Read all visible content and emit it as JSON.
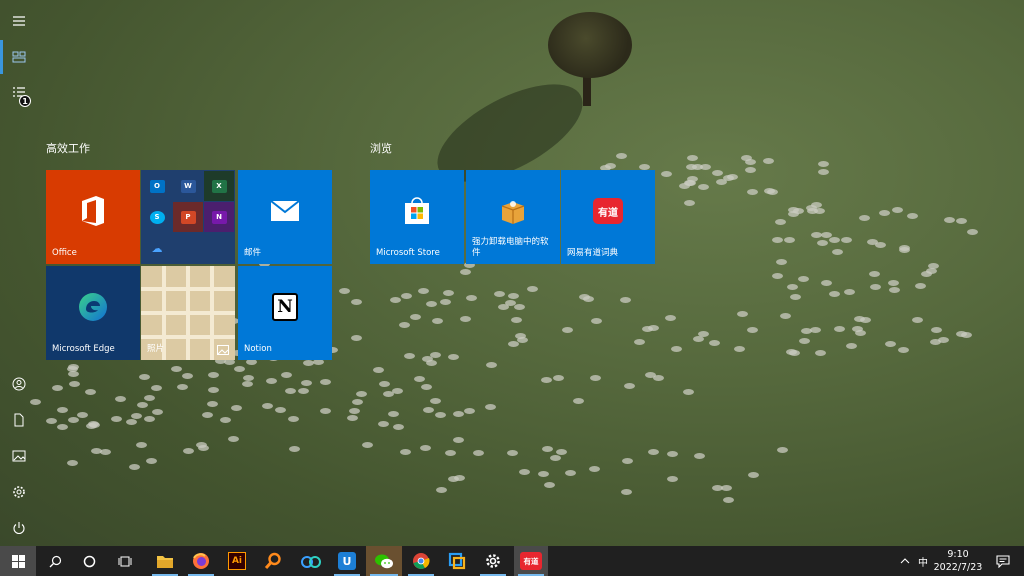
{
  "start_menu": {
    "groups": [
      {
        "title": "高效工作",
        "tiles": [
          {
            "label": "Office"
          },
          {
            "label": "邮件"
          },
          {
            "label": "Microsoft Edge"
          },
          {
            "label": "照片"
          },
          {
            "label": "Notion"
          }
        ],
        "mini_apps": [
          {
            "icon": "outlook-icon",
            "glyph": "O",
            "color": "#0072c6"
          },
          {
            "icon": "word-icon",
            "glyph": "W",
            "color": "#2b579a"
          },
          {
            "icon": "excel-icon",
            "glyph": "X",
            "color": "#217346"
          },
          {
            "icon": "skype-icon",
            "glyph": "S",
            "color": "#00aff0"
          },
          {
            "icon": "powerpoint-icon",
            "glyph": "P",
            "color": "#d24726"
          },
          {
            "icon": "onenote-icon",
            "glyph": "N",
            "color": "#7719aa"
          },
          {
            "icon": "onedrive-icon",
            "glyph": "☁",
            "color": "#0078d4"
          }
        ]
      },
      {
        "title": "浏览",
        "tiles": [
          {
            "label": "Microsoft Store"
          },
          {
            "label": "强力卸载电脑中的软件"
          },
          {
            "label": "网易有道词典"
          }
        ]
      }
    ],
    "youdao_logo_text": "有道",
    "notion_glyph": "N",
    "office_glyph": "O",
    "rail_badge": "1"
  },
  "taskbar": {
    "apps": [
      {
        "name": "file-explorer"
      },
      {
        "name": "firefox"
      },
      {
        "name": "illustrator",
        "glyph": "Ai"
      },
      {
        "name": "search-everything"
      },
      {
        "name": "baidu-netdisk"
      },
      {
        "name": "uninstaller",
        "glyph": "U"
      },
      {
        "name": "wechat"
      },
      {
        "name": "chrome"
      },
      {
        "name": "snipaste"
      },
      {
        "name": "settings"
      },
      {
        "name": "youdao",
        "glyph": "有道"
      }
    ],
    "ime": "中",
    "time": "9:10",
    "date": "2022/7/23"
  },
  "colors": {
    "tile_blue": "#0078d7",
    "office_orange": "#d83b01",
    "taskbar": "#202020",
    "accent": "#3a96dd"
  }
}
